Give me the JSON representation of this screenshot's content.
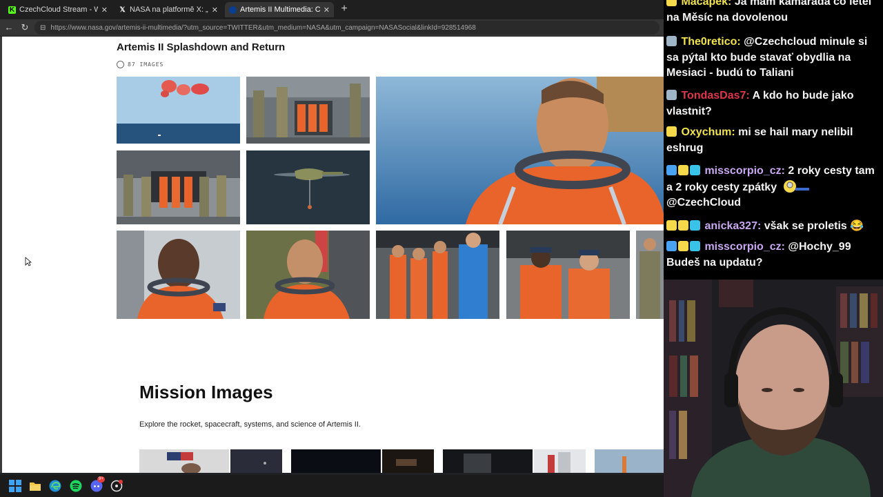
{
  "browser": {
    "tabs": [
      {
        "title": "CzechCloud Stream - Watch Live o",
        "icon": "kick-icon",
        "active": false
      },
      {
        "title": "NASA na platformě X: „Let's run th",
        "icon": "x-icon",
        "active": false
      },
      {
        "title": "Artemis II Multimedia: Crew Photo",
        "icon": "nasa-icon",
        "active": true
      }
    ],
    "new_tab": "+",
    "url": "https://www.nasa.gov/artemis-ii-multimedia/?utm_source=TWITTER&utm_medium=NASA&utm_campaign=NASASocial&linkId=928514968"
  },
  "page": {
    "gallery_title": "Artemis II Splashdown and Return",
    "image_count": "87 IMAGES",
    "mission_title": "Mission Images",
    "mission_desc": "Explore the rocket, spacecraft, systems, and science of Artemis II."
  },
  "taskbar": {
    "icons": [
      "windows-start-icon",
      "file-explorer-icon",
      "edge-icon",
      "spotify-icon",
      "discord-icon",
      "app-icon"
    ],
    "discord_badge": "9+"
  },
  "chat": {
    "messages": [
      {
        "user": "Macapek",
        "color": "#f2e34c",
        "badges": [
          "#f5d94a"
        ],
        "text": "Já mám kamaráda co letěl na Měsíc na dovolenou"
      },
      {
        "user": "The0retico",
        "color": "#f2e34c",
        "badges": [
          "#9fb6c8"
        ],
        "text": "@Czechcloud minule si sa pýtal kto bude stavať obydlia na Mesiaci - budú to Taliani"
      },
      {
        "user": "TondasDas7",
        "color": "#e0364a",
        "badges": [
          "#9fb6c8"
        ],
        "text": "A kdo ho bude jako vlastnit?"
      },
      {
        "user": "Oxychum",
        "color": "#f2e34c",
        "badges": [
          "#f5d94a"
        ],
        "text": "mi se hail mary nelibil eshrug"
      },
      {
        "user": "misscorpio_cz",
        "color": "#c9a8f2",
        "badges": [
          "#4aa3f2",
          "#f5d94a",
          "#39c3e8"
        ],
        "text": "2 roky cesty tam a 2 roky cesty zpátky",
        "emote": "minion-emote",
        "text2": "@CzechCloud"
      },
      {
        "user": "anicka327",
        "color": "#c9a8f2",
        "badges": [
          "#f5d94a",
          "#f5d94a",
          "#39c3e8"
        ],
        "text": "však se proletis 😂"
      },
      {
        "user": "misscorpio_cz",
        "color": "#c9a8f2",
        "badges": [
          "#4aa3f2",
          "#f5d94a",
          "#39c3e8"
        ],
        "text": "@Hochy_99 Budeš na updatu?"
      }
    ]
  },
  "colors": {
    "page_bg": "#ffffff",
    "chrome_bg": "#1f1f1f",
    "address_bg": "#353535",
    "taskbar_bg": "#1b1b1b",
    "chat_bg": "#000000",
    "suit_orange": "#e8642a"
  }
}
